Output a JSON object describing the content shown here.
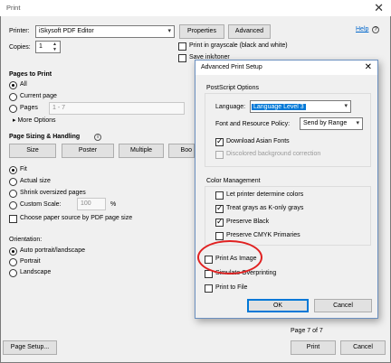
{
  "window": {
    "title": "Print",
    "close": "✕"
  },
  "printer": {
    "label": "Printer:",
    "value": "iSkysoft PDF Editor",
    "properties": "Properties",
    "advanced": "Advanced",
    "help": "Help"
  },
  "copies": {
    "label": "Copies:",
    "value": "1"
  },
  "grayscale": "Print in grayscale (black and white)",
  "save_ink": "Save ink/toner",
  "pages": {
    "heading": "Pages to Print",
    "all": "All",
    "current": "Current page",
    "pages": "Pages",
    "range": "1 - 7",
    "more": "More Options"
  },
  "sizing": {
    "heading": "Page Sizing & Handling",
    "size": "Size",
    "poster": "Poster",
    "multiple": "Multiple",
    "booklet": "Boo",
    "fit": "Fit",
    "actual": "Actual size",
    "shrink": "Shrink oversized pages",
    "custom": "Custom Scale:",
    "custom_value": "100",
    "percent": "%",
    "paper_source": "Choose paper source by PDF page size"
  },
  "orientation": {
    "heading": "Orientation:",
    "auto": "Auto portrait/landscape",
    "portrait": "Portrait",
    "landscape": "Landscape"
  },
  "footer": {
    "page_setup": "Page Setup...",
    "page_of": "Page 7 of 7",
    "print": "Print",
    "cancel": "Cancel"
  },
  "dialog": {
    "title": "Advanced Print Setup",
    "close": "✕",
    "postscript_heading": "PostScript Options",
    "language_label": "Language:",
    "language_value": "Language Level 3",
    "policy_label": "Font and Resource Policy:",
    "policy_value": "Send by Range",
    "download_fonts": "Download Asian Fonts",
    "discolored": "Discolored background correction",
    "color_heading": "Color Management",
    "let_printer": "Let printer determine colors",
    "treat_grays": "Treat grays as K-only grays",
    "preserve_black": "Preserve Black",
    "preserve_cmyk": "Preserve CMYK Primaries",
    "print_as_image": "Print As Image",
    "simulate": "Simulate Overprinting",
    "print_to_file": "Print to File",
    "ok": "OK",
    "cancel": "Cancel"
  },
  "colors": {
    "accent": "#0078d7",
    "highlight_circle": "#e02020",
    "link": "#0066cc"
  }
}
